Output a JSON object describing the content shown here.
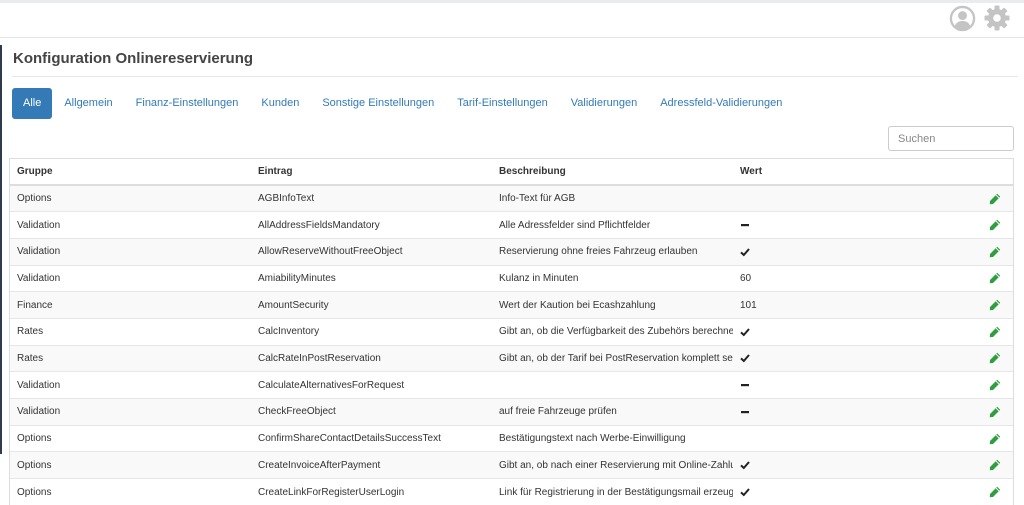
{
  "header": {
    "user_icon": "user-circle-icon",
    "settings_icon": "gear-icon"
  },
  "page": {
    "title": "Konfiguration Onlinereservierung"
  },
  "tabs": [
    {
      "label": "Alle",
      "active": true
    },
    {
      "label": "Allgemein",
      "active": false
    },
    {
      "label": "Finanz-Einstellungen",
      "active": false
    },
    {
      "label": "Kunden",
      "active": false
    },
    {
      "label": "Sonstige Einstellungen",
      "active": false
    },
    {
      "label": "Tarif-Einstellungen",
      "active": false
    },
    {
      "label": "Validierungen",
      "active": false
    },
    {
      "label": "Adressfeld-Validierungen",
      "active": false
    }
  ],
  "search": {
    "placeholder": "Suchen",
    "value": ""
  },
  "table": {
    "columns": [
      "Gruppe",
      "Eintrag",
      "Beschreibung",
      "Wert"
    ],
    "rows": [
      {
        "group": "Options",
        "entry": "AGBInfoText",
        "description": "Info-Text für AGB",
        "value": "",
        "value_icon": ""
      },
      {
        "group": "Validation",
        "entry": "AllAddressFieldsMandatory",
        "description": "Alle Adressfelder sind Pflichtfelder",
        "value": "",
        "value_icon": "minus-icon"
      },
      {
        "group": "Validation",
        "entry": "AllowReserveWithoutFreeObject",
        "description": "Reservierung ohne freies Fahrzeug erlauben",
        "value": "",
        "value_icon": "check-icon"
      },
      {
        "group": "Validation",
        "entry": "AmiabilityMinutes",
        "description": "Kulanz in Minuten",
        "value": "60",
        "value_icon": ""
      },
      {
        "group": "Finance",
        "entry": "AmountSecurity",
        "description": "Wert der Kaution bei Ecashzahlung",
        "value": "101",
        "value_icon": ""
      },
      {
        "group": "Rates",
        "entry": "CalcInventory",
        "description": "Gibt an, ob die Verfügbarkeit des Zubehörs berechnet und",
        "value": "",
        "value_icon": "check-icon"
      },
      {
        "group": "Rates",
        "entry": "CalcRateInPostReservation",
        "description": "Gibt an, ob der Tarif bei PostReservation komplett serverseitig",
        "value": "",
        "value_icon": "check-icon"
      },
      {
        "group": "Validation",
        "entry": "CalculateAlternativesForRequest",
        "description": "",
        "value": "",
        "value_icon": "minus-icon"
      },
      {
        "group": "Validation",
        "entry": "CheckFreeObject",
        "description": "auf freie Fahrzeuge prüfen",
        "value": "",
        "value_icon": "minus-icon"
      },
      {
        "group": "Options",
        "entry": "ConfirmShareContactDetailsSuccessText",
        "description": "Bestätigungstext nach Werbe-Einwilligung",
        "value": "",
        "value_icon": ""
      },
      {
        "group": "Options",
        "entry": "CreateInvoiceAfterPayment",
        "description": "Gibt an, ob nach einer Reservierung mit Online-Zahlung eine",
        "value": "",
        "value_icon": "check-icon"
      },
      {
        "group": "Options",
        "entry": "CreateLinkForRegisterUserLogin",
        "description": "Link für Registrierung in der Bestätigungsmail erzeugen",
        "value": "",
        "value_icon": "check-icon"
      }
    ],
    "edit_icon": "pencil-icon"
  },
  "colors": {
    "accent": "#337ab7",
    "edit_icon": "#2e9e3e",
    "sidebar": "#2f3b4c"
  }
}
